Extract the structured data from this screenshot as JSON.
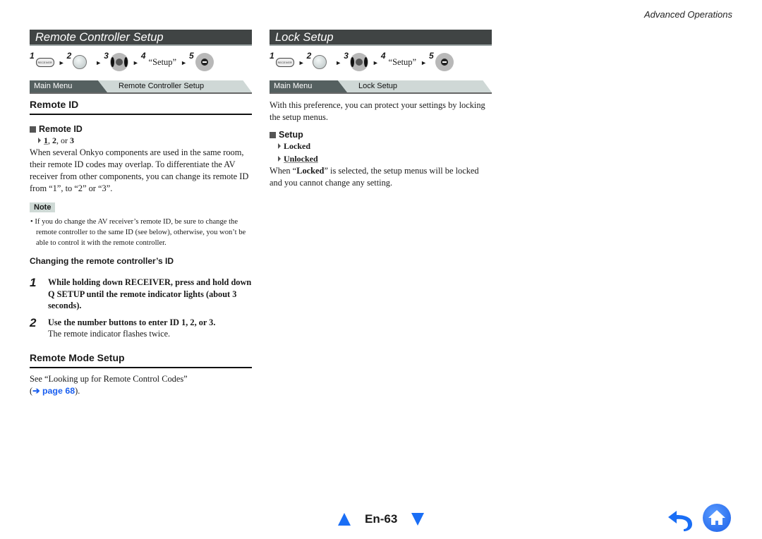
{
  "header": {
    "section": "Advanced Operations"
  },
  "left": {
    "title": "Remote Controller Setup",
    "steps": [
      {
        "num": "1",
        "icon": "receiver-button-icon",
        "label": "RECEIVER"
      },
      {
        "num": "2",
        "icon": "home-button-icon",
        "label": "HOME"
      },
      {
        "num": "3",
        "icon": "dpad-left-right-icon",
        "label": "MENU"
      },
      {
        "num": "4",
        "text": "“Setup”"
      },
      {
        "num": "5",
        "icon": "dpad-enter-icon",
        "label": "ENTER"
      }
    ],
    "menu_path": {
      "main": "Main Menu",
      "current": "Remote Controller Setup"
    },
    "remote_id": {
      "heading": "Remote ID",
      "sub_heading": "Remote ID",
      "options": [
        "1",
        ", ",
        "2",
        ", or ",
        "3"
      ],
      "body": "When several Onkyo components are used in the same room, their remote ID codes may overlap. To differentiate the AV receiver from other components, you can change its remote ID from “1”, to “2” or “3”.",
      "note_label": "Note",
      "note": "If you do change the AV receiver’s remote ID, be sure to change the remote controller to the same ID (see below), otherwise, you won’t be able to control it with the remote controller.",
      "changing_heading": "Changing the remote controller’s ID",
      "steps": [
        {
          "num": "1",
          "text": "While holding down RECEIVER, press and hold down Q SETUP until the remote indicator lights (about 3 seconds)."
        },
        {
          "num": "2",
          "text": "Use the number buttons to enter ID 1, 2, or 3.",
          "subtext": "The remote indicator flashes twice."
        }
      ]
    },
    "remote_mode": {
      "heading": "Remote Mode Setup",
      "body": "See “Looking up for Remote Control Codes”",
      "link": "➔ page 68",
      "open": "(",
      "close": ")."
    }
  },
  "right": {
    "title": "Lock Setup",
    "steps": [
      {
        "num": "1",
        "icon": "receiver-button-icon",
        "label": "RECEIVER"
      },
      {
        "num": "2",
        "icon": "home-button-icon",
        "label": "HOME"
      },
      {
        "num": "3",
        "icon": "dpad-left-right-icon",
        "label": "MENU"
      },
      {
        "num": "4",
        "text": "“Setup”"
      },
      {
        "num": "5",
        "icon": "dpad-enter-icon",
        "label": "ENTER"
      }
    ],
    "menu_path": {
      "main": "Main Menu",
      "current": "Lock Setup"
    },
    "intro": "With this preference, you can protect your settings by locking the setup menus.",
    "sub_heading": "Setup",
    "options": [
      "Locked",
      "Unlocked"
    ],
    "body_pre": "When “",
    "body_bold": "Locked",
    "body_post": "” is selected, the setup menus will be locked and you cannot change any setting."
  },
  "footer": {
    "page": "En-63",
    "prev": "previous-page",
    "next": "next-page"
  },
  "colors": {
    "title_bar": "#404444",
    "accent_blue": "#1a6ef5",
    "menu_path_bg": "#cfd8d6"
  }
}
